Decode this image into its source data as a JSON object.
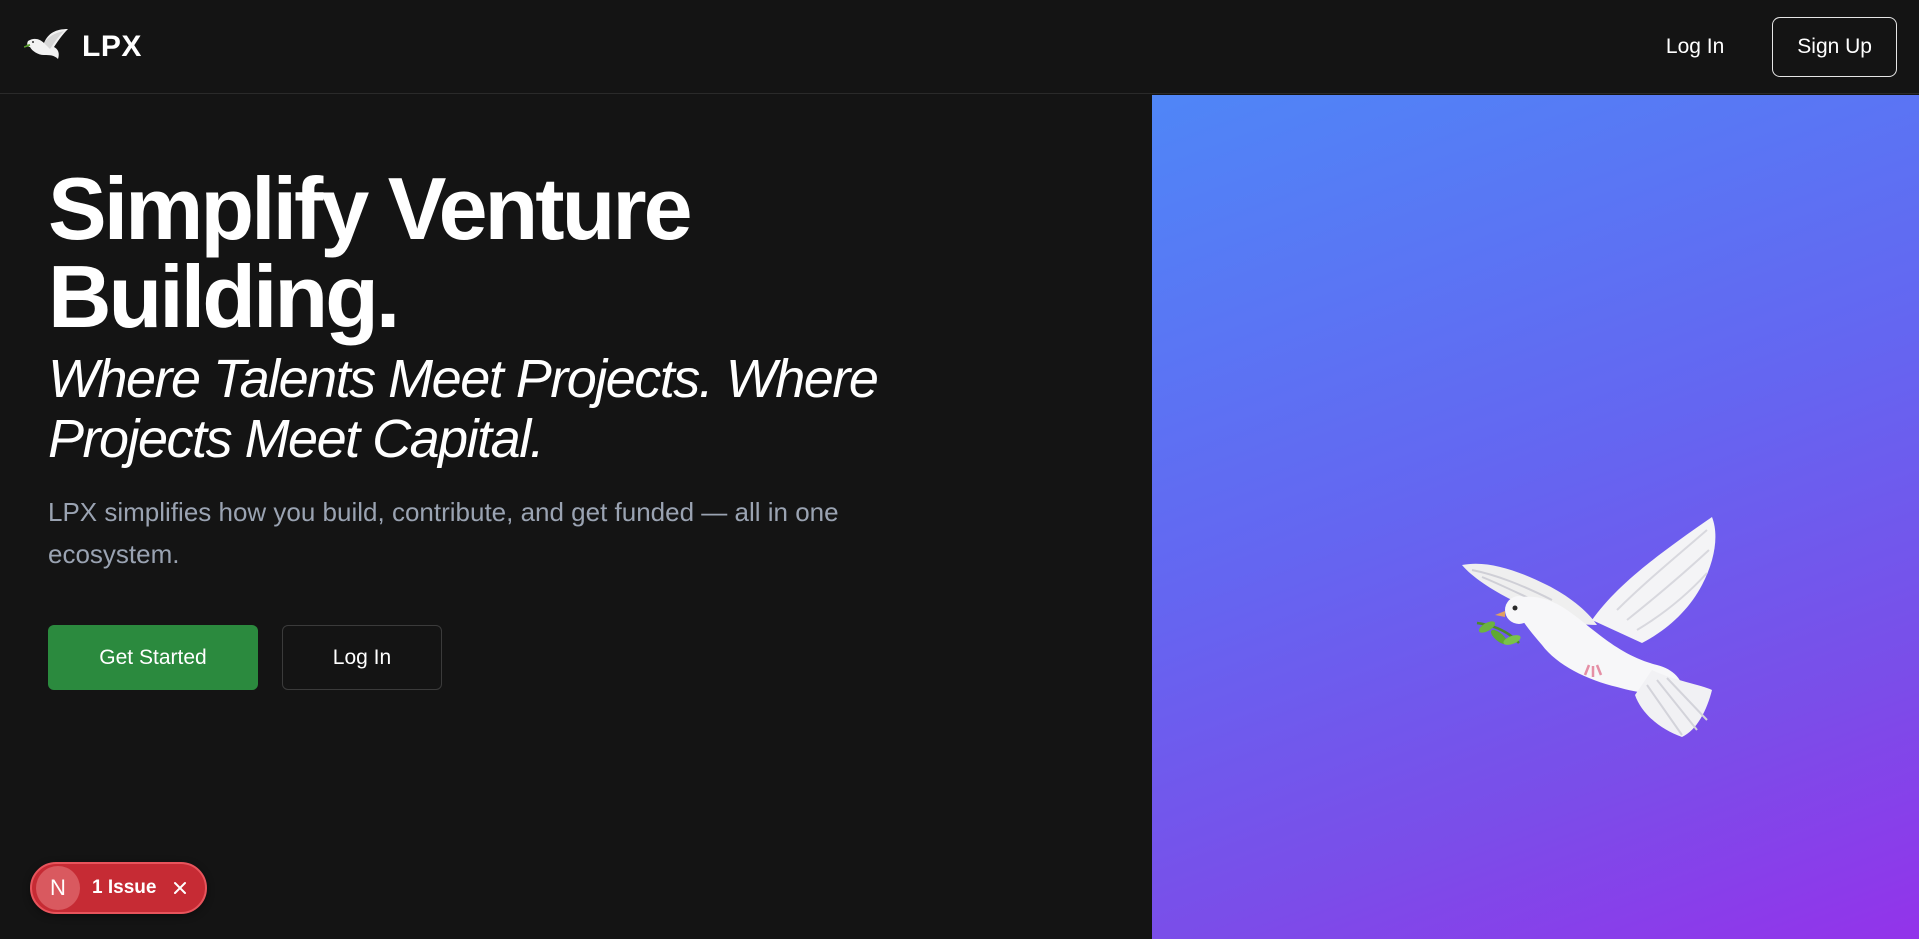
{
  "header": {
    "brand_name": "LPX",
    "brand_icon": "dove-icon",
    "login_label": "Log In",
    "signup_label": "Sign Up"
  },
  "hero": {
    "title_line1": "Simplify Venture",
    "title_line2": "Building.",
    "subtitle": "Where Talents Meet Projects. Where Projects Meet Capital.",
    "description": "LPX simplifies how you build, contribute, and get funded — all in one ecosystem.",
    "primary_cta": "Get Started",
    "secondary_cta": "Log In"
  },
  "issue_badge": {
    "initial": "N",
    "label": "1 Issue",
    "close_icon": "close-icon"
  },
  "visual": {
    "image_icon": "dove-with-olive-branch-icon"
  },
  "colors": {
    "background": "#141414",
    "primary_button": "#2b8a3e",
    "gradient_start": "#4f86f7",
    "gradient_end": "#9333ea",
    "issue_badge": "#c62b34"
  }
}
